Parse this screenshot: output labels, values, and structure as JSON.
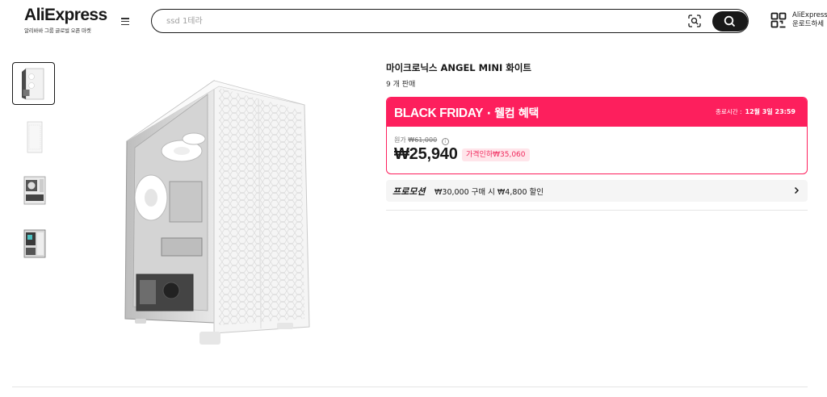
{
  "header": {
    "logo_text": "AliExpress",
    "logo_subtitle": "알리바바 그룹 글로벌 오픈 마켓",
    "search_placeholder": "ssd 1테라",
    "app_line1": "AliExpress",
    "app_line2": "운로드하세"
  },
  "product": {
    "title": "마이크로닉스 ANGEL MINI 화이트",
    "sold": "9 개 판매",
    "deal": {
      "title_en": "BLACK FRIDAY",
      "title_sep": " · ",
      "title_kr": "웰컴 혜택",
      "end_label": "종료시간 :",
      "end_value": "12월 3일 23:59",
      "accent_color": "#fd1f5d"
    },
    "original_label": "원가",
    "original_price": "₩61,000",
    "price": "₩25,940",
    "discount_badge": "가격인하₩35,060",
    "promo_label": "프로모션",
    "promo_text": "₩30,000 구매 시 ₩4,800 할인"
  },
  "thumbnails": [
    {
      "name": "front-view"
    },
    {
      "name": "side-view"
    },
    {
      "name": "interior-view"
    },
    {
      "name": "rear-view"
    }
  ],
  "icons": {
    "menu": "hamburger-icon",
    "camera": "image-search-icon",
    "search": "search-icon",
    "qr": "qr-code-icon",
    "info": "info-icon",
    "chevron": "chevron-right-icon"
  }
}
